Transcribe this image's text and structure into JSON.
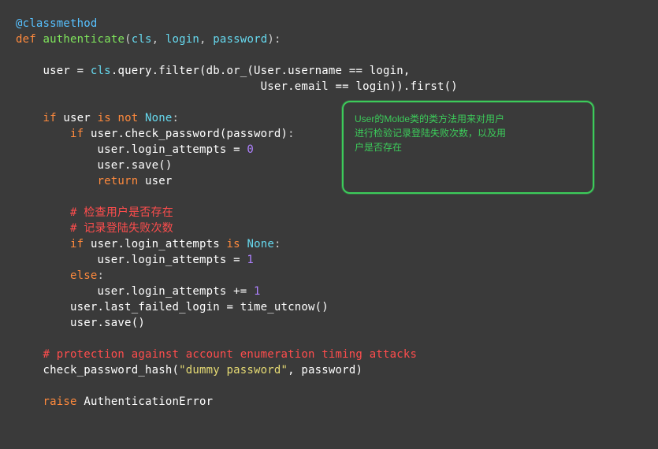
{
  "code": {
    "decorator": "@classmethod",
    "def": "def",
    "fn_name": "authenticate",
    "params": {
      "cls": "cls",
      "login": "login",
      "password": "password"
    },
    "line_user_assign": "user = ",
    "cls_ref": "cls",
    "query_filter": ".query.filter(db.or_(User.username == login,",
    "query_filter2": "User.email == login)).first()",
    "if1": "if",
    "is_not": "is not",
    "none": "None",
    "user_txt": "user",
    "check_pw": "user.check_password(password)",
    "la_eq_0": "user.login_attempts = ",
    "zero": "0",
    "save": "user.save()",
    "return": "return",
    "return_v": "user",
    "cm_exist": "# 检查用户是否存在",
    "cm_record": "# 记录登陆失败次数",
    "if2": "if",
    "la_is": "user.login_attempts",
    "is_kw": "is",
    "la_eq_1": "user.login_attempts = ",
    "one": "1",
    "else": "else",
    "la_pluseq": "user.login_attempts += ",
    "last_fail": "user.last_failed_login = time_utcnow()",
    "save2": "user.save()",
    "cm_prot": "# protection against account enumeration timing attacks",
    "cph": "check_password_hash(",
    "dummy": "\"dummy password\"",
    "cph_tail": ", password)",
    "raise": "raise",
    "exc": "AuthenticationError"
  },
  "callout": {
    "line1": "User的Molde类的类方法用来对用户",
    "line2": "进行检验记录登陆失败次数，以及用",
    "line3": "户是否存在"
  }
}
